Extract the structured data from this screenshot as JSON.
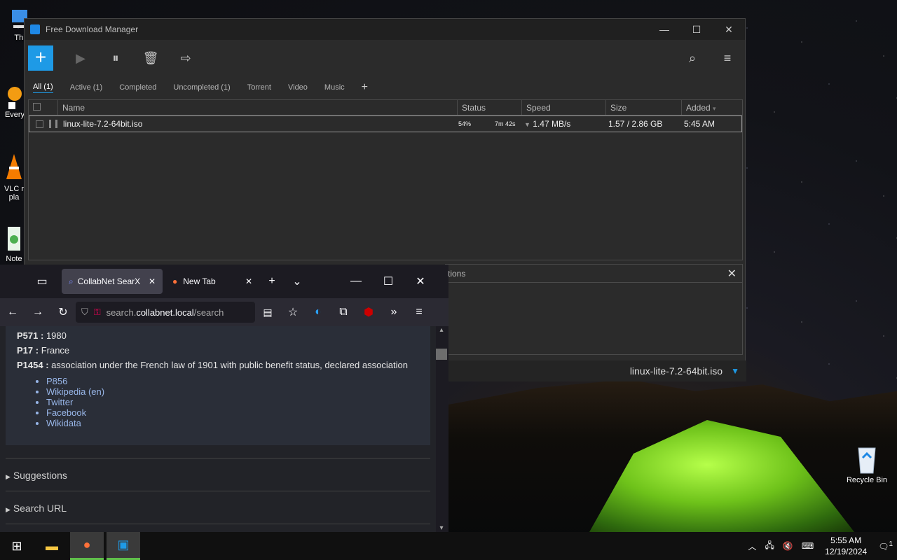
{
  "desktop": {
    "icons": [
      {
        "label": "Thi",
        "icon": "this-pc-icon"
      },
      {
        "label": "Every",
        "icon": "everything-icon"
      },
      {
        "label": "VLC r pla",
        "icon": "vlc-icon"
      },
      {
        "label": "Note",
        "icon": "notepad-icon"
      },
      {
        "label": "Recycle Bin",
        "icon": "recycle-bin-icon"
      }
    ]
  },
  "fdm": {
    "title": "Free Download Manager",
    "tabs": [
      "All (1)",
      "Active (1)",
      "Completed",
      "Uncompleted (1)",
      "Torrent",
      "Video",
      "Music"
    ],
    "add_tab": "+",
    "columns": {
      "name": "Name",
      "status": "Status",
      "speed": "Speed",
      "size": "Size",
      "added": "Added"
    },
    "row": {
      "name": "linux-lite-7.2-64bit.iso",
      "progress": "54%",
      "eta": "7m 42s",
      "speed": "1.47 MB/s",
      "size": "1.57 / 2.86 GB",
      "added": "5:45 AM"
    },
    "info_panel_title": "tions",
    "bottom_file": "linux-lite-7.2-64bit.iso"
  },
  "firefox": {
    "tabs": [
      {
        "title": "CollabNet SearX",
        "active": true
      },
      {
        "title": "New Tab",
        "active": false
      }
    ],
    "url_prefix": "search.",
    "url_host": "collabnet.local",
    "url_path": "/search",
    "content": {
      "props": [
        {
          "key": "P571 :",
          "value": "1980"
        },
        {
          "key": "P17 :",
          "value": "France"
        },
        {
          "key": "P1454 :",
          "value": "association under the French law of 1901 with public benefit status, declared association"
        }
      ],
      "links": [
        "P856",
        "Wikipedia (en)",
        "Twitter",
        "Facebook",
        "Wikidata"
      ],
      "sections": [
        "Suggestions",
        "Search URL"
      ]
    }
  },
  "taskbar": {
    "time": "5:55 AM",
    "date": "12/19/2024",
    "notification_count": "1"
  }
}
